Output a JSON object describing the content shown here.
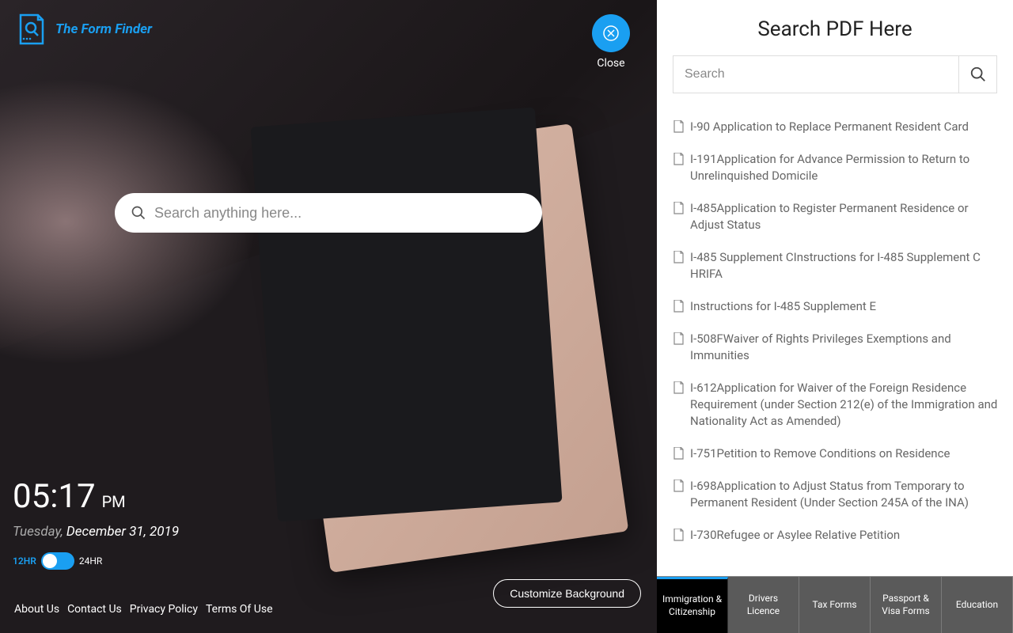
{
  "brand": {
    "name": "The Form Finder"
  },
  "close": {
    "label": "Close"
  },
  "mainSearch": {
    "placeholder": "Search anything here..."
  },
  "clock": {
    "time": "05:17",
    "ampm": "PM",
    "weekday": "Tuesday,",
    "dateRest": "December 31, 2019",
    "hr12": "12HR",
    "hr24": "24HR"
  },
  "footer": {
    "links": [
      "About Us",
      "Contact Us",
      "Privacy Policy",
      "Terms Of Use"
    ]
  },
  "customize": "Customize Background",
  "rightPanel": {
    "title": "Search PDF Here",
    "searchPlaceholder": "Search",
    "items": [
      "I-90 Application to Replace Permanent Resident Card",
      "I-191Application for Advance Permission to Return to Unrelinquished Domicile",
      "I-485Application to Register Permanent Residence or Adjust Status",
      "I-485 Supplement CInstructions for I-485 Supplement C HRIFA",
      "Instructions for I-485 Supplement E",
      "I-508FWaiver of Rights Privileges Exemptions and Immunities",
      "I-612Application for Waiver of the Foreign Residence Requirement (under Section 212(e) of the Immigration and Nationality Act as Amended)",
      "I-751Petition to Remove Conditions on Residence",
      "I-698Application to Adjust Status from Temporary to Permanent Resident (Under Section 245A of the INA)",
      "I-730Refugee or Asylee Relative Petition"
    ]
  },
  "tabs": [
    {
      "label": "Immigration & Citizenship",
      "active": true
    },
    {
      "label": "Drivers Licence",
      "active": false
    },
    {
      "label": "Tax Forms",
      "active": false
    },
    {
      "label": "Passport & Visa Forms",
      "active": false
    },
    {
      "label": "Education",
      "active": false
    }
  ],
  "colors": {
    "accent": "#1a9ff1"
  }
}
